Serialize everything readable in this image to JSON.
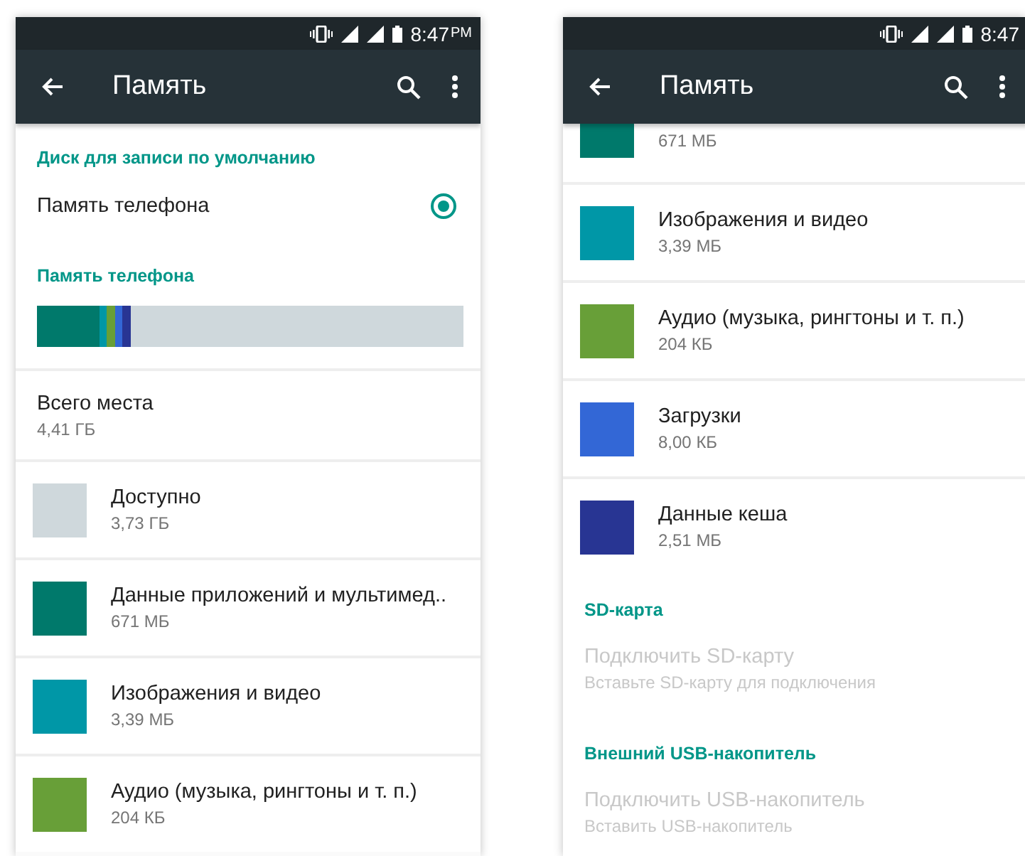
{
  "screens": [
    {
      "status_bar": {
        "time": "8:47",
        "ampm": "PM"
      },
      "app_bar": {
        "title": "Память"
      },
      "sections": [
        {
          "kind": "header",
          "text": "Диск для записи по умолчанию"
        },
        {
          "kind": "radio",
          "label": "Память телефона",
          "selected": true
        },
        {
          "kind": "header",
          "text": "Память телефона"
        },
        {
          "kind": "bar"
        },
        {
          "kind": "total",
          "title": "Всего места",
          "value": "4,41 ГБ"
        },
        {
          "kind": "item",
          "color": "#cfd8dc",
          "title": "Доступно",
          "value": "3,73 ГБ"
        },
        {
          "kind": "item",
          "color": "#00796b",
          "title": "Данные приложений и мультимед..",
          "value": "671 МБ"
        },
        {
          "kind": "item",
          "color": "#0097a7",
          "title": "Изображения и видео",
          "value": "3,39 МБ"
        },
        {
          "kind": "item",
          "color": "#689f38",
          "title": "Аудио (музыка, рингтоны и т. п.)",
          "value": "204 КБ"
        }
      ]
    },
    {
      "status_bar": {
        "time": "8:47"
      },
      "app_bar": {
        "title": "Память"
      },
      "sections": [
        {
          "kind": "partial",
          "color": "#00796b",
          "value": "671 МБ"
        },
        {
          "kind": "item",
          "color": "#0097a7",
          "title": "Изображения и видео",
          "value": "3,39 МБ"
        },
        {
          "kind": "item",
          "color": "#689f38",
          "title": "Аудио (музыка, рингтоны и т. п.)",
          "value": "204 КБ"
        },
        {
          "kind": "item",
          "color": "#3367d6",
          "title": "Загрузки",
          "value": "8,00 КБ"
        },
        {
          "kind": "item",
          "color": "#283593",
          "title": "Данные кеша",
          "value": "2,51 МБ"
        },
        {
          "kind": "header",
          "text": "SD-карта"
        },
        {
          "kind": "action",
          "title": "Подключить SD-карту",
          "value": "Вставьте SD-карту для подключения",
          "disabled": true
        },
        {
          "kind": "header",
          "text": "Внешний USB-накопитель"
        },
        {
          "kind": "action",
          "title": "Подключить USB-накопитель",
          "value": "Вставить USB-накопитель",
          "disabled": true
        }
      ]
    }
  ]
}
